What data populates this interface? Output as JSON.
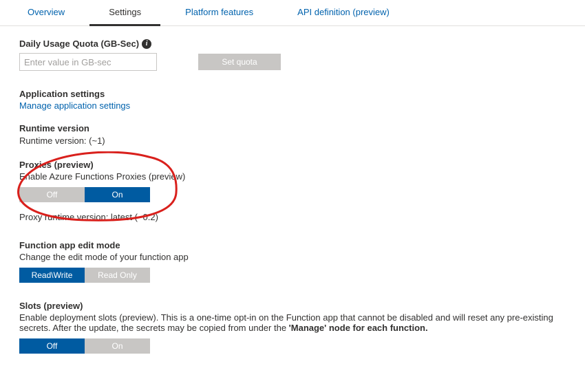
{
  "tabs": {
    "overview": "Overview",
    "settings": "Settings",
    "platform": "Platform features",
    "apidef": "API definition (preview)"
  },
  "quota": {
    "title": "Daily Usage Quota (GB-Sec)",
    "placeholder": "Enter value in GB-sec",
    "set_button": "Set quota"
  },
  "app_settings": {
    "title": "Application settings",
    "link": "Manage application settings"
  },
  "runtime": {
    "title": "Runtime version",
    "value": "Runtime version: (~1)"
  },
  "proxies": {
    "title": "Proxies (preview)",
    "subtitle": "Enable Azure Functions Proxies (preview)",
    "off": "Off",
    "on": "On",
    "runtime": "Proxy runtime version: latest (~0.2)"
  },
  "edit_mode": {
    "title": "Function app edit mode",
    "subtitle": "Change the edit mode of your function app",
    "rw": "Read\\Write",
    "ro": "Read Only"
  },
  "slots": {
    "title": "Slots (preview)",
    "subtitle_a": "Enable deployment slots (preview). This is a one-time opt-in on the Function app that cannot be disabled and will reset any pre-existing secrets. After the update, the secrets may be copied from under the ",
    "subtitle_b": "'Manage' node for each function.",
    "off": "Off",
    "on": "On"
  }
}
